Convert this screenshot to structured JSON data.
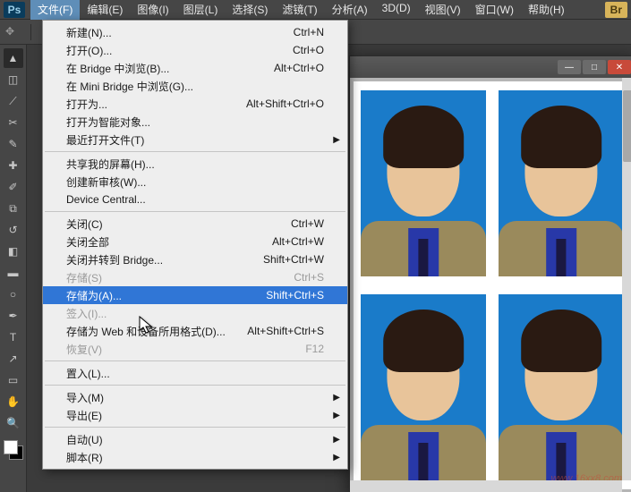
{
  "app": {
    "logo": "Ps",
    "br": "Br"
  },
  "menubar": [
    {
      "label": "文件(F)",
      "active": true
    },
    {
      "label": "编辑(E)"
    },
    {
      "label": "图像(I)"
    },
    {
      "label": "图层(L)"
    },
    {
      "label": "选择(S)"
    },
    {
      "label": "滤镜(T)"
    },
    {
      "label": "分析(A)"
    },
    {
      "label": "3D(D)"
    },
    {
      "label": "视图(V)"
    },
    {
      "label": "窗口(W)"
    },
    {
      "label": "帮助(H)"
    }
  ],
  "dropdown": [
    {
      "type": "item",
      "label": "新建(N)...",
      "shortcut": "Ctrl+N"
    },
    {
      "type": "item",
      "label": "打开(O)...",
      "shortcut": "Ctrl+O"
    },
    {
      "type": "item",
      "label": "在 Bridge 中浏览(B)...",
      "shortcut": "Alt+Ctrl+O"
    },
    {
      "type": "item",
      "label": "在 Mini Bridge 中浏览(G)..."
    },
    {
      "type": "item",
      "label": "打开为...",
      "shortcut": "Alt+Shift+Ctrl+O"
    },
    {
      "type": "item",
      "label": "打开为智能对象..."
    },
    {
      "type": "item",
      "label": "最近打开文件(T)",
      "submenu": true
    },
    {
      "type": "sep"
    },
    {
      "type": "item",
      "label": "共享我的屏幕(H)..."
    },
    {
      "type": "item",
      "label": "创建新审核(W)..."
    },
    {
      "type": "item",
      "label": "Device Central..."
    },
    {
      "type": "sep"
    },
    {
      "type": "item",
      "label": "关闭(C)",
      "shortcut": "Ctrl+W"
    },
    {
      "type": "item",
      "label": "关闭全部",
      "shortcut": "Alt+Ctrl+W"
    },
    {
      "type": "item",
      "label": "关闭并转到 Bridge...",
      "shortcut": "Shift+Ctrl+W"
    },
    {
      "type": "item",
      "label": "存储(S)",
      "shortcut": "Ctrl+S",
      "disabled": true
    },
    {
      "type": "item",
      "label": "存储为(A)...",
      "shortcut": "Shift+Ctrl+S",
      "highlight": true
    },
    {
      "type": "item",
      "label": "签入(I)...",
      "disabled": true
    },
    {
      "type": "item",
      "label": "存储为 Web 和设备所用格式(D)...",
      "shortcut": "Alt+Shift+Ctrl+S"
    },
    {
      "type": "item",
      "label": "恢复(V)",
      "shortcut": "F12",
      "disabled": true
    },
    {
      "type": "sep"
    },
    {
      "type": "item",
      "label": "置入(L)..."
    },
    {
      "type": "sep"
    },
    {
      "type": "item",
      "label": "导入(M)",
      "submenu": true
    },
    {
      "type": "item",
      "label": "导出(E)",
      "submenu": true
    },
    {
      "type": "sep"
    },
    {
      "type": "item",
      "label": "自动(U)",
      "submenu": true
    },
    {
      "type": "item",
      "label": "脚本(R)",
      "submenu": true
    }
  ],
  "watermark": "www.16xx8.com"
}
